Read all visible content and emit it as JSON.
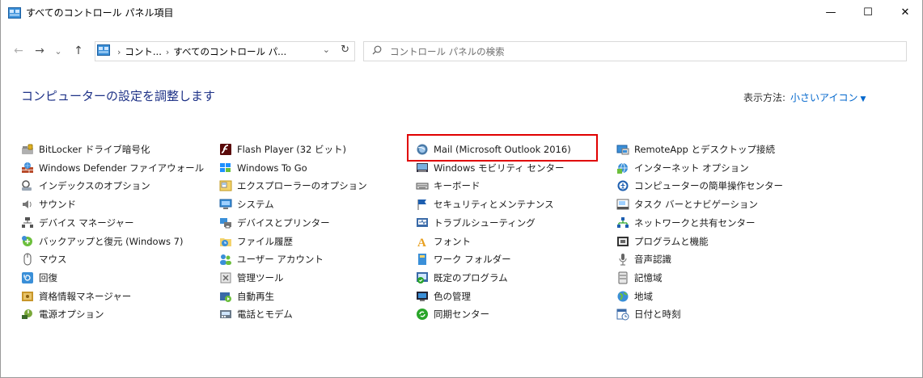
{
  "window": {
    "title": "すべてのコントロール パネル項目",
    "minimize": "—",
    "maximize": "☐",
    "close": "✕"
  },
  "nav": {
    "back": "←",
    "forward": "→",
    "recent": "⌄",
    "up": "↑"
  },
  "address": {
    "crumb1": "コント...",
    "crumb2": "すべてのコントロール パ...",
    "separator": "›",
    "dropdown": "⌄",
    "refresh": "↻"
  },
  "search": {
    "placeholder": "コントロール パネルの検索"
  },
  "header": {
    "title": "コンピューターの設定を調整します",
    "view_by_label": "表示方法:",
    "view_by_value": "小さいアイコン",
    "view_by_caret": "▼"
  },
  "columns": [
    {
      "items": [
        {
          "label": "BitLocker ドライブ暗号化",
          "icon": "bitlocker-icon"
        },
        {
          "label": "Windows Defender ファイアウォール",
          "icon": "firewall-icon"
        },
        {
          "label": "インデックスのオプション",
          "icon": "indexing-icon"
        },
        {
          "label": "サウンド",
          "icon": "sound-icon"
        },
        {
          "label": "デバイス マネージャー",
          "icon": "device-manager-icon"
        },
        {
          "label": "バックアップと復元 (Windows 7)",
          "icon": "backup-icon"
        },
        {
          "label": "マウス",
          "icon": "mouse-icon"
        },
        {
          "label": "回復",
          "icon": "recovery-icon"
        },
        {
          "label": "資格情報マネージャー",
          "icon": "credential-icon"
        },
        {
          "label": "電源オプション",
          "icon": "power-icon"
        }
      ]
    },
    {
      "items": [
        {
          "label": "Flash Player (32 ビット)",
          "icon": "flash-icon"
        },
        {
          "label": "Windows To Go",
          "icon": "windows-to-go-icon"
        },
        {
          "label": "エクスプローラーのオプション",
          "icon": "explorer-options-icon"
        },
        {
          "label": "システム",
          "icon": "system-icon"
        },
        {
          "label": "デバイスとプリンター",
          "icon": "printer-icon"
        },
        {
          "label": "ファイル履歴",
          "icon": "file-history-icon"
        },
        {
          "label": "ユーザー アカウント",
          "icon": "users-icon"
        },
        {
          "label": "管理ツール",
          "icon": "admin-tools-icon"
        },
        {
          "label": "自動再生",
          "icon": "autoplay-icon"
        },
        {
          "label": "電話とモデム",
          "icon": "modem-icon"
        }
      ]
    },
    {
      "items": [
        {
          "label": "Mail (Microsoft Outlook 2016)",
          "icon": "mail-icon"
        },
        {
          "label": "Windows モビリティ センター",
          "icon": "mobility-icon"
        },
        {
          "label": "キーボード",
          "icon": "keyboard-icon"
        },
        {
          "label": "セキュリティとメンテナンス",
          "icon": "flag-icon"
        },
        {
          "label": "トラブルシューティング",
          "icon": "troubleshoot-icon"
        },
        {
          "label": "フォント",
          "icon": "font-icon"
        },
        {
          "label": "ワーク フォルダー",
          "icon": "work-folders-icon"
        },
        {
          "label": "既定のプログラム",
          "icon": "default-programs-icon"
        },
        {
          "label": "色の管理",
          "icon": "color-management-icon"
        },
        {
          "label": "同期センター",
          "icon": "sync-icon"
        }
      ]
    },
    {
      "items": [
        {
          "label": "RemoteApp とデスクトップ接続",
          "icon": "remoteapp-icon"
        },
        {
          "label": "インターネット オプション",
          "icon": "internet-options-icon"
        },
        {
          "label": "コンピューターの簡単操作センター",
          "icon": "ease-of-access-icon"
        },
        {
          "label": "タスク バーとナビゲーション",
          "icon": "taskbar-icon"
        },
        {
          "label": "ネットワークと共有センター",
          "icon": "network-icon"
        },
        {
          "label": "プログラムと機能",
          "icon": "programs-icon"
        },
        {
          "label": "音声認識",
          "icon": "microphone-icon"
        },
        {
          "label": "記憶域",
          "icon": "storage-icon"
        },
        {
          "label": "地域",
          "icon": "region-icon"
        },
        {
          "label": "日付と時刻",
          "icon": "clock-icon"
        }
      ]
    }
  ]
}
